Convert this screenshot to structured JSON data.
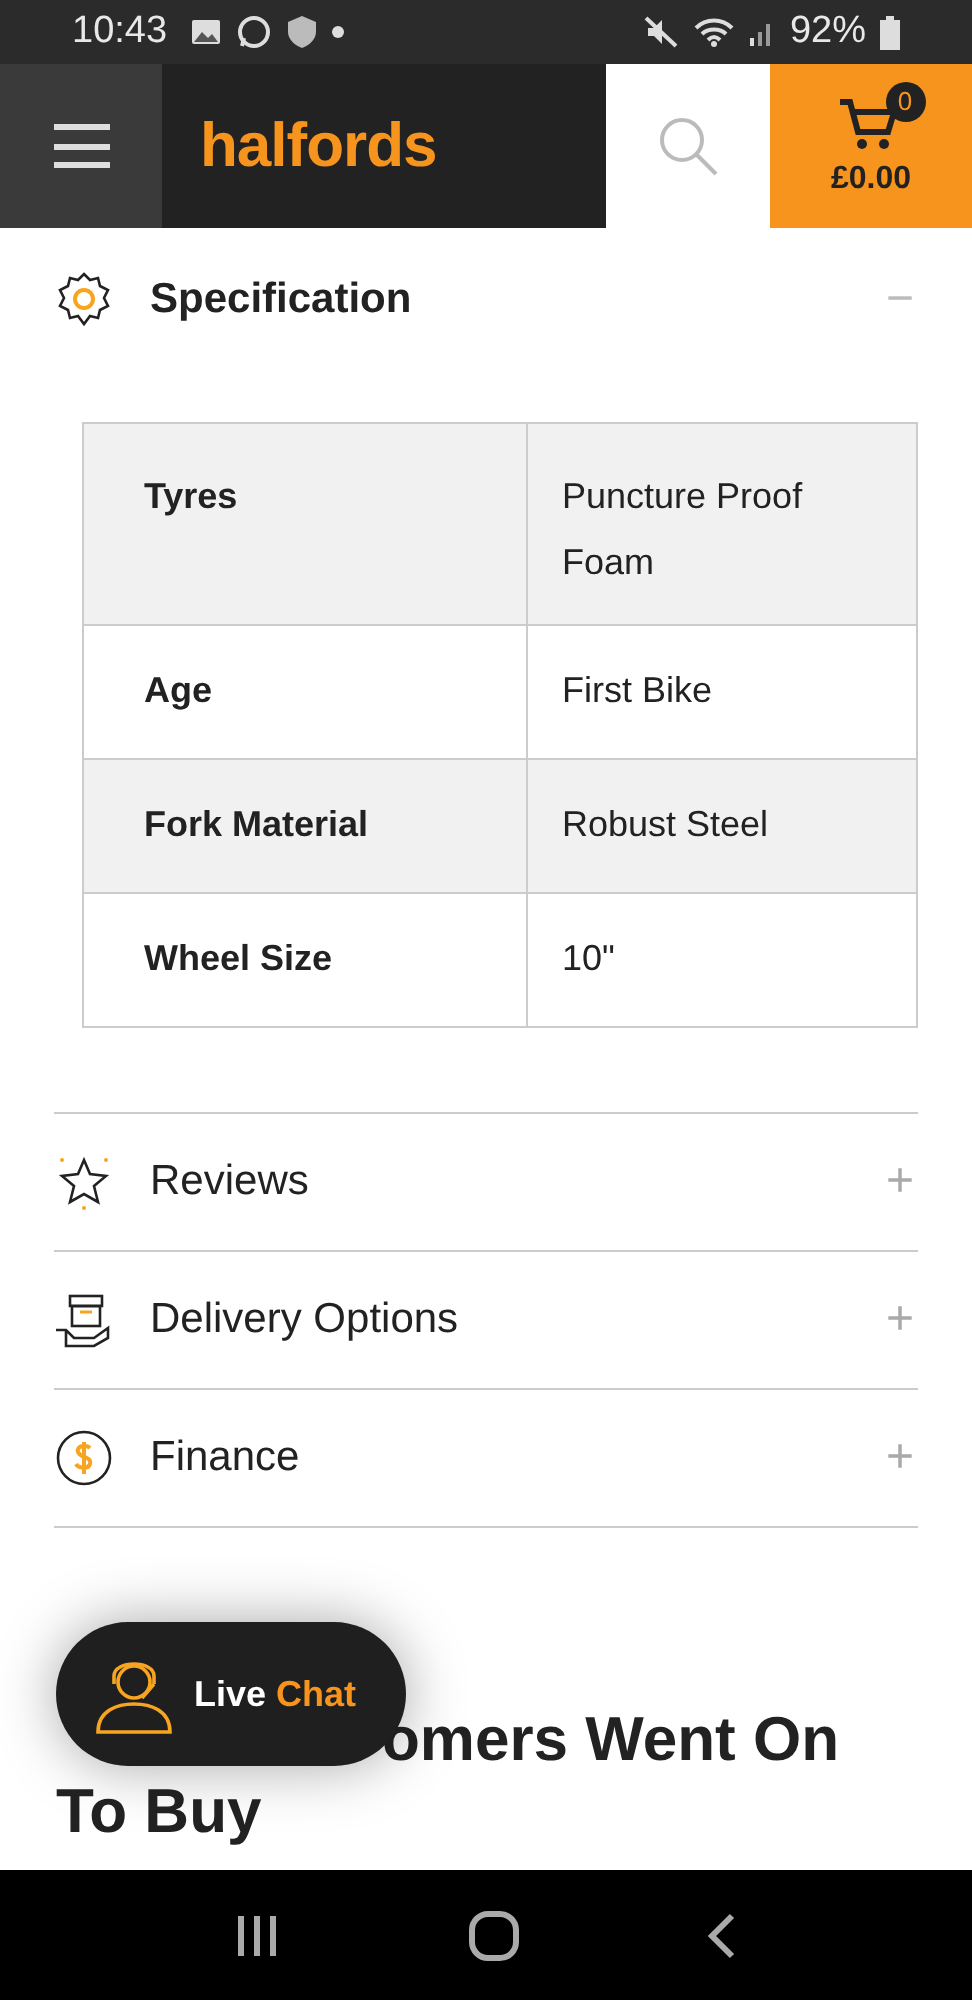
{
  "status_bar": {
    "time": "10:43",
    "battery": "92%"
  },
  "header": {
    "logo": "halfords",
    "cart_count": "0",
    "cart_total": "£0.00"
  },
  "specification": {
    "title": "Specification",
    "expanded": true,
    "toggle": "−",
    "rows": [
      {
        "label": "Tyres",
        "value": "Puncture Proof Foam"
      },
      {
        "label": "Age",
        "value": "First Bike"
      },
      {
        "label": "Fork Material",
        "value": "Robust Steel"
      },
      {
        "label": "Wheel Size",
        "value": "10\""
      }
    ]
  },
  "sections": [
    {
      "kind": "star",
      "title": "Reviews",
      "expanded": false,
      "toggle": "+"
    },
    {
      "kind": "delivery",
      "title": "Delivery Options",
      "expanded": false,
      "toggle": "+"
    },
    {
      "kind": "finance",
      "title": "Finance",
      "expanded": false,
      "toggle": "+"
    }
  ],
  "heading_lines": [
    "omers Went On",
    "To Buy"
  ],
  "live_chat": {
    "label_1": "Live",
    "label_2": "Chat"
  }
}
